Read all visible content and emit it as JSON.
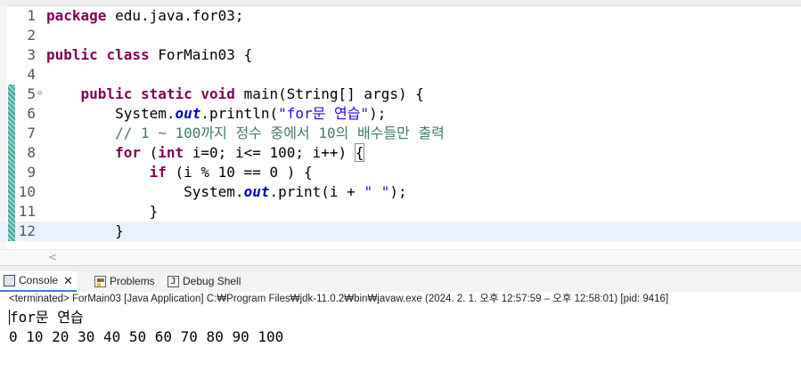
{
  "editor": {
    "lines": [
      {
        "num": "1",
        "tokens": [
          {
            "t": "package",
            "c": "kw"
          },
          {
            "t": " edu.java.for03;",
            "c": ""
          }
        ]
      },
      {
        "num": "2",
        "tokens": []
      },
      {
        "num": "3",
        "tokens": [
          {
            "t": "public",
            "c": "kw"
          },
          {
            "t": " ",
            "c": ""
          },
          {
            "t": "class",
            "c": "kw"
          },
          {
            "t": " ForMain03 {",
            "c": ""
          }
        ]
      },
      {
        "num": "4",
        "tokens": []
      },
      {
        "num": "5",
        "fold": "⊖",
        "ruler": true,
        "tokens": [
          {
            "t": "    ",
            "c": ""
          },
          {
            "t": "public",
            "c": "kw"
          },
          {
            "t": " ",
            "c": ""
          },
          {
            "t": "static",
            "c": "kw"
          },
          {
            "t": " ",
            "c": ""
          },
          {
            "t": "void",
            "c": "kw"
          },
          {
            "t": " main(String[] args) {",
            "c": ""
          }
        ]
      },
      {
        "num": "6",
        "ruler": true,
        "tokens": [
          {
            "t": "        System.",
            "c": ""
          },
          {
            "t": "out",
            "c": "fld"
          },
          {
            "t": ".println(",
            "c": ""
          },
          {
            "t": "\"for문 연습\"",
            "c": "str"
          },
          {
            "t": ");",
            "c": ""
          }
        ]
      },
      {
        "num": "7",
        "ruler": true,
        "tokens": [
          {
            "t": "        ",
            "c": ""
          },
          {
            "t": "// 1 ~ 100까지 정수 중에서 10의 배수들만 출력",
            "c": "cm"
          }
        ]
      },
      {
        "num": "8",
        "ruler": true,
        "tokens": [
          {
            "t": "        ",
            "c": ""
          },
          {
            "t": "for",
            "c": "kw"
          },
          {
            "t": " (",
            "c": ""
          },
          {
            "t": "int",
            "c": "kw"
          },
          {
            "t": " i=0; i<= 100; i++) ",
            "c": ""
          },
          {
            "t": "{",
            "c": "bracket"
          }
        ]
      },
      {
        "num": "9",
        "ruler": true,
        "tokens": [
          {
            "t": "            ",
            "c": ""
          },
          {
            "t": "if",
            "c": "kw"
          },
          {
            "t": " (i % 10 == 0 ) {",
            "c": ""
          }
        ]
      },
      {
        "num": "10",
        "ruler": true,
        "tokens": [
          {
            "t": "                System.",
            "c": ""
          },
          {
            "t": "out",
            "c": "fld"
          },
          {
            "t": ".print(i + ",
            "c": ""
          },
          {
            "t": "\" \"",
            "c": "str"
          },
          {
            "t": ");",
            "c": ""
          }
        ]
      },
      {
        "num": "11",
        "ruler": true,
        "tokens": [
          {
            "t": "            }",
            "c": ""
          }
        ]
      },
      {
        "num": "12",
        "ruler": true,
        "current": true,
        "tokens": [
          {
            "t": "        }",
            "c": ""
          }
        ]
      }
    ],
    "scroll_left_arrow": "<"
  },
  "console": {
    "tabs": [
      {
        "label": "Console",
        "icon": "console-icon",
        "active": true,
        "closable": true
      },
      {
        "label": "Problems",
        "icon": "problems-icon"
      },
      {
        "label": "Debug Shell",
        "icon": "debug-shell-icon",
        "glyph": "J"
      }
    ],
    "close_glyph": "✕",
    "status": "<terminated> ForMain03 [Java Application] C:₩Program Files₩jdk-11.0.2₩bin₩javaw.exe  (2024. 2. 1. 오후 12:57:59 – 오후 12:58:01) [pid: 9416]",
    "output": [
      "for문 연습",
      "0 10 20 30 40 50 60 70 80 90 100"
    ]
  }
}
